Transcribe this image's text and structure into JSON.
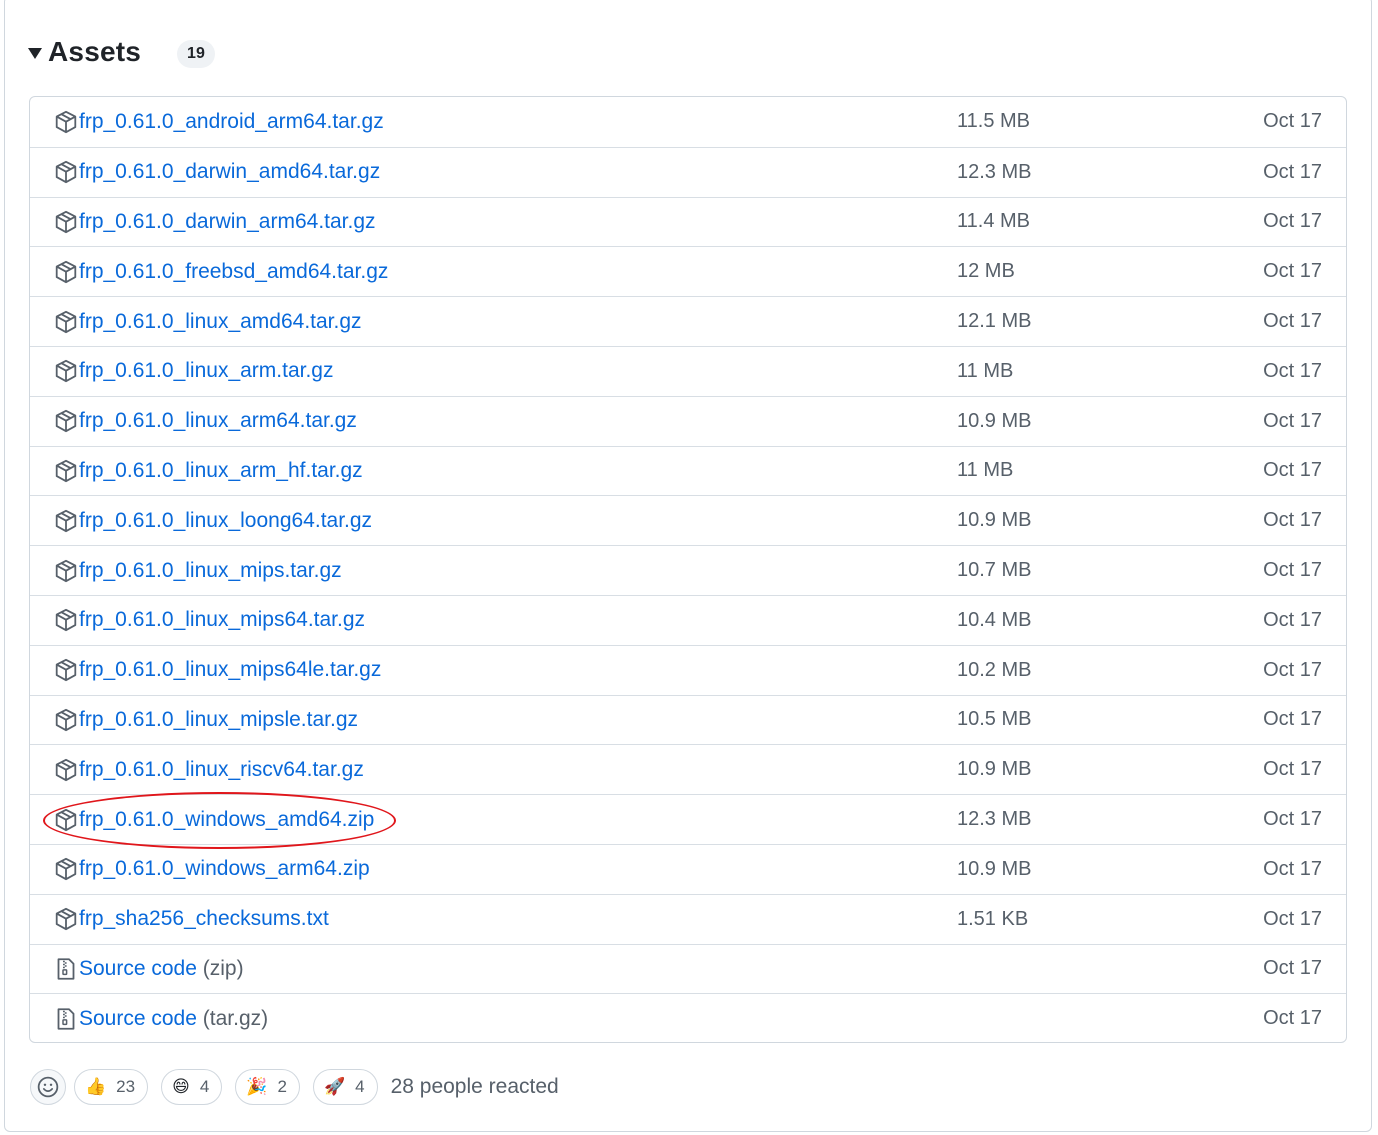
{
  "assets": {
    "title": "Assets",
    "count": "19",
    "items": [
      {
        "name": "frp_0.61.0_android_arm64.tar.gz",
        "size": "11.5 MB",
        "date": "Oct 17",
        "icon": "package-icon"
      },
      {
        "name": "frp_0.61.0_darwin_amd64.tar.gz",
        "size": "12.3 MB",
        "date": "Oct 17",
        "icon": "package-icon"
      },
      {
        "name": "frp_0.61.0_darwin_arm64.tar.gz",
        "size": "11.4 MB",
        "date": "Oct 17",
        "icon": "package-icon"
      },
      {
        "name": "frp_0.61.0_freebsd_amd64.tar.gz",
        "size": "12 MB",
        "date": "Oct 17",
        "icon": "package-icon"
      },
      {
        "name": "frp_0.61.0_linux_amd64.tar.gz",
        "size": "12.1 MB",
        "date": "Oct 17",
        "icon": "package-icon"
      },
      {
        "name": "frp_0.61.0_linux_arm.tar.gz",
        "size": "11 MB",
        "date": "Oct 17",
        "icon": "package-icon"
      },
      {
        "name": "frp_0.61.0_linux_arm64.tar.gz",
        "size": "10.9 MB",
        "date": "Oct 17",
        "icon": "package-icon"
      },
      {
        "name": "frp_0.61.0_linux_arm_hf.tar.gz",
        "size": "11 MB",
        "date": "Oct 17",
        "icon": "package-icon"
      },
      {
        "name": "frp_0.61.0_linux_loong64.tar.gz",
        "size": "10.9 MB",
        "date": "Oct 17",
        "icon": "package-icon"
      },
      {
        "name": "frp_0.61.0_linux_mips.tar.gz",
        "size": "10.7 MB",
        "date": "Oct 17",
        "icon": "package-icon"
      },
      {
        "name": "frp_0.61.0_linux_mips64.tar.gz",
        "size": "10.4 MB",
        "date": "Oct 17",
        "icon": "package-icon"
      },
      {
        "name": "frp_0.61.0_linux_mips64le.tar.gz",
        "size": "10.2 MB",
        "date": "Oct 17",
        "icon": "package-icon"
      },
      {
        "name": "frp_0.61.0_linux_mipsle.tar.gz",
        "size": "10.5 MB",
        "date": "Oct 17",
        "icon": "package-icon"
      },
      {
        "name": "frp_0.61.0_linux_riscv64.tar.gz",
        "size": "10.9 MB",
        "date": "Oct 17",
        "icon": "package-icon"
      },
      {
        "name": "frp_0.61.0_windows_amd64.zip",
        "size": "12.3 MB",
        "date": "Oct 17",
        "icon": "package-icon",
        "highlighted": true
      },
      {
        "name": "frp_0.61.0_windows_arm64.zip",
        "size": "10.9 MB",
        "date": "Oct 17",
        "icon": "package-icon"
      },
      {
        "name": "frp_sha256_checksums.txt",
        "size": "1.51 KB",
        "date": "Oct 17",
        "icon": "package-icon"
      },
      {
        "name": "Source code",
        "suffix": "(zip)",
        "size": "",
        "date": "Oct 17",
        "icon": "file-zip-icon"
      },
      {
        "name": "Source code",
        "suffix": "(tar.gz)",
        "size": "",
        "date": "Oct 17",
        "icon": "file-zip-icon"
      }
    ]
  },
  "reactions": {
    "items": [
      {
        "emoji": "👍",
        "count": "23",
        "icon": "thumbs-up-icon"
      },
      {
        "emoji": "😄",
        "count": "4",
        "icon": "laugh-icon"
      },
      {
        "emoji": "🎉",
        "count": "2",
        "icon": "hooray-icon"
      },
      {
        "emoji": "🚀",
        "count": "4",
        "icon": "rocket-icon"
      }
    ],
    "summary": "28 people reacted"
  },
  "colors": {
    "link": "#0969da",
    "muted": "#57606a",
    "border": "#d0d7de",
    "highlight": "#e0161b"
  }
}
